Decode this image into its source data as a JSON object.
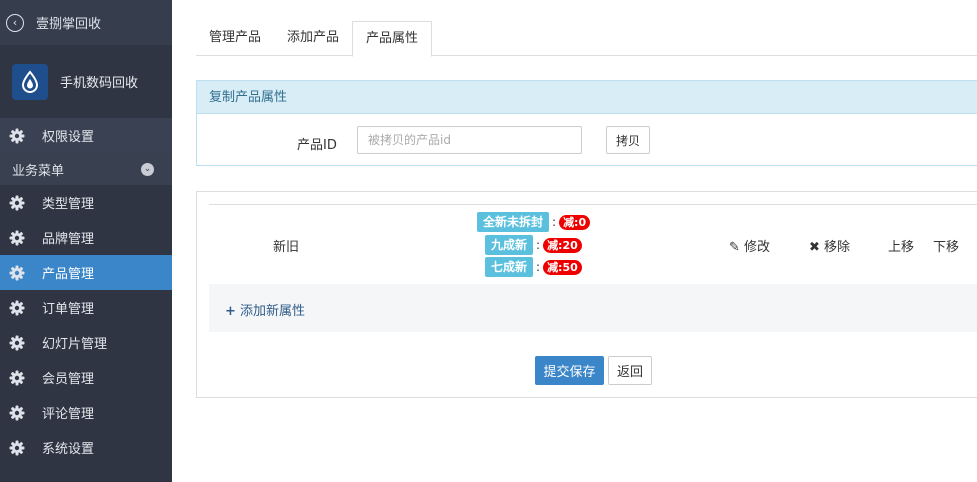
{
  "sidebar": {
    "top_title": "壹捌掌回收",
    "brand_name": "手机数码回收",
    "permission": "权限设置",
    "section_title": "业务菜单",
    "items": [
      {
        "label": "类型管理"
      },
      {
        "label": "品牌管理"
      },
      {
        "label": "产品管理"
      },
      {
        "label": "订单管理"
      },
      {
        "label": "幻灯片管理"
      },
      {
        "label": "会员管理"
      },
      {
        "label": "评论管理"
      },
      {
        "label": "系统设置"
      }
    ]
  },
  "tabs": [
    {
      "label": "管理产品"
    },
    {
      "label": "添加产品"
    },
    {
      "label": "产品属性"
    }
  ],
  "copy_panel": {
    "title": "复制产品属性",
    "field_label": "产品ID",
    "input_placeholder": "被拷贝的产品id",
    "input_value": "",
    "button": "拷贝"
  },
  "attribute": {
    "name": "新旧",
    "options": [
      {
        "label": "全新未拆封",
        "colon": ":",
        "discount": "减:0"
      },
      {
        "label": "九成新",
        "colon": ":",
        "discount": "减:20"
      },
      {
        "label": "七成新",
        "colon": ":",
        "discount": "减:50"
      }
    ],
    "actions": {
      "edit": "修改",
      "remove": "移除",
      "up": "上移",
      "down": "下移"
    }
  },
  "add_attribute": "添加新属性",
  "buttons": {
    "submit": "提交保存",
    "back": "返回"
  },
  "colors": {
    "sidebar_bg": "#2f3543",
    "active": "#3b86c8",
    "tag": "#5bc0de",
    "discount": "#ee0000"
  }
}
